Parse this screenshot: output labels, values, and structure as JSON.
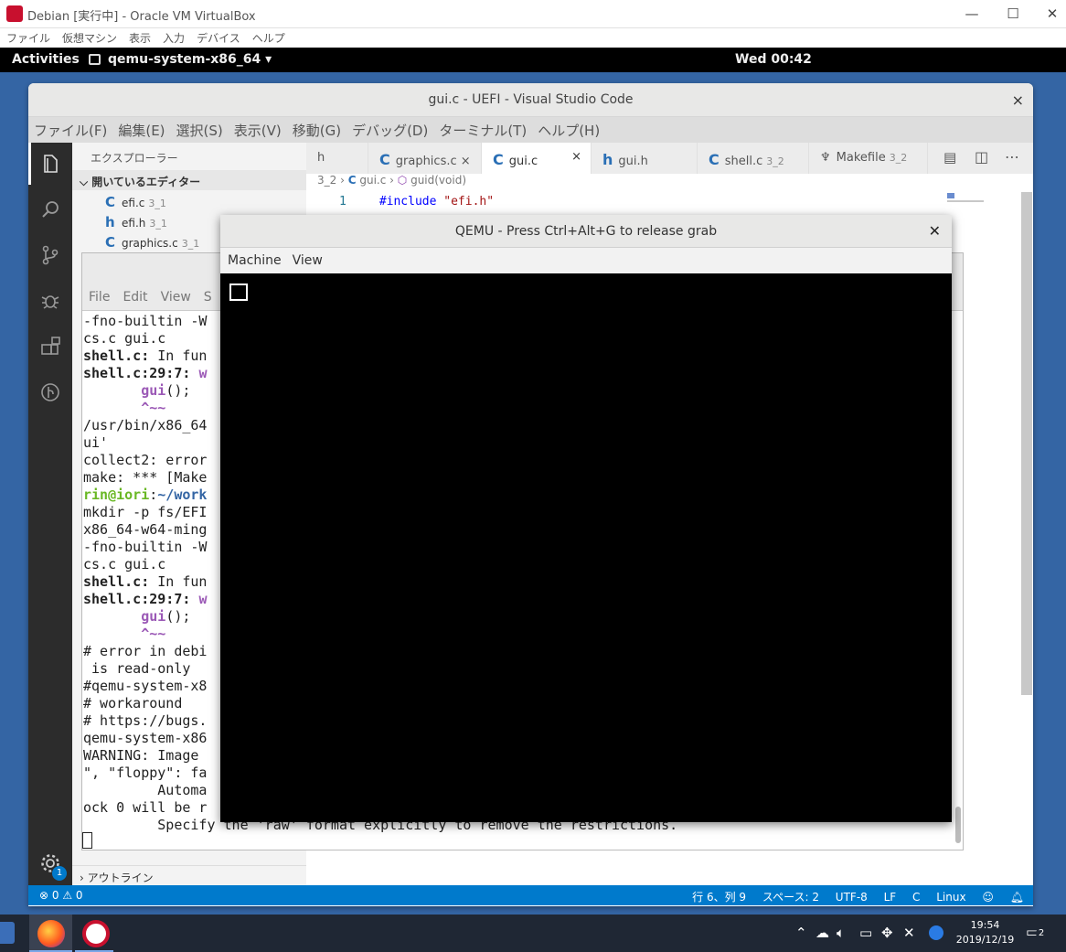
{
  "vbox": {
    "title": "Debian [実行中] - Oracle VM VirtualBox",
    "menu": [
      "ファイル",
      "仮想マシン",
      "表示",
      "入力",
      "デバイス",
      "ヘルプ"
    ],
    "minimize": "—",
    "maximize": "☐",
    "close": "✕"
  },
  "gnome": {
    "activities": "Activities",
    "app": "qemu-system-x86_64 ▾",
    "clock": "Wed 00:42"
  },
  "vscode": {
    "title": "gui.c - UEFI - Visual Studio Code",
    "close": "×",
    "menu": [
      "ファイル(F)",
      "編集(E)",
      "選択(S)",
      "表示(V)",
      "移動(G)",
      "デバッグ(D)",
      "ターミナル(T)",
      "ヘルプ(H)"
    ],
    "explorer_header": "エクスプローラー",
    "open_editors": "開いているエディター",
    "files": [
      {
        "icon": "C",
        "name": "efi.c",
        "dir": "3_1"
      },
      {
        "icon": "h",
        "name": "efi.h",
        "dir": "3_1"
      },
      {
        "icon": "C",
        "name": "graphics.c",
        "dir": "3_1"
      }
    ],
    "outline": "アウトライン",
    "tabs": [
      {
        "icon": "",
        "name": "h",
        "dir": ""
      },
      {
        "icon": "C",
        "name": "graphics.c",
        "dir": "",
        "close": "×"
      },
      {
        "icon": "C",
        "name": "gui.c",
        "dir": "",
        "close": "×"
      },
      {
        "icon": "h",
        "name": "gui.h",
        "dir": ""
      },
      {
        "icon": "C",
        "name": "shell.c",
        "dir": "3_2"
      },
      {
        "icon": "",
        "name": "Makefile",
        "dir": "3_2"
      }
    ],
    "breadcrumb": {
      "dir": "3_2",
      "file": "gui.c",
      "symbol": "guid(void)"
    },
    "line_number": "1",
    "code_keyword": "#include",
    "code_string": "\"efi.h\"",
    "status": {
      "errors": "⊗ 0",
      "warnings": "⚠ 0",
      "position": "行 6、列 9",
      "spaces": "スペース: 2",
      "encoding": "UTF-8",
      "eol": "LF",
      "lang_mode": "C",
      "os": "Linux"
    },
    "settings_badge": "1"
  },
  "terminal": {
    "menu": [
      "File",
      "Edit",
      "View",
      "S"
    ]
  },
  "qemu": {
    "title": "QEMU - Press Ctrl+Alt+G to release grab",
    "close": "✕",
    "menu": [
      "Machine",
      "View"
    ]
  },
  "taskbar": {
    "time": "19:54",
    "date": "2019/12/19",
    "notifications": "2"
  },
  "colors": {
    "vscode_blue": "#007acc",
    "gnome_bar": "#000000",
    "taskbar": "#1f2734"
  }
}
